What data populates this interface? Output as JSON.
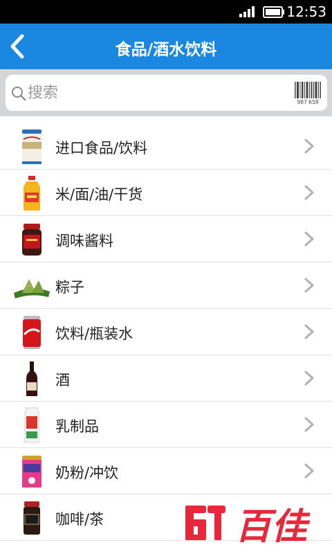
{
  "status_bar": {
    "time": "12:53",
    "signal_icon": "signal-icon",
    "battery_icon": "battery-icon"
  },
  "header": {
    "title": "食品/酒水饮料",
    "back_icon": "chevron-left-icon"
  },
  "search": {
    "placeholder": "搜索",
    "value": "",
    "barcode_icon": "barcode-icon",
    "barcode_number": "987 658"
  },
  "categories": [
    {
      "label": "进口食品/饮料",
      "icon": "wafer-can-icon"
    },
    {
      "label": "米/面/油/干货",
      "icon": "oil-bottle-icon"
    },
    {
      "label": "调味酱料",
      "icon": "sauce-jar-icon"
    },
    {
      "label": "粽子",
      "icon": "zongzi-icon"
    },
    {
      "label": "饮料/瓶装水",
      "icon": "cola-can-icon"
    },
    {
      "label": "酒",
      "icon": "wine-bottle-icon"
    },
    {
      "label": "乳制品",
      "icon": "milk-carton-icon"
    },
    {
      "label": "奶粉/冲饮",
      "icon": "milk-powder-can-icon"
    },
    {
      "label": "咖啡/茶",
      "icon": "coffee-jar-icon"
    }
  ],
  "brand": {
    "logo_text": "百佳",
    "logo_icon": "brand-logo"
  },
  "colors": {
    "header": "#1a87e0",
    "search_bg": "#d4d6d8",
    "logo_red": "#e8283a"
  }
}
